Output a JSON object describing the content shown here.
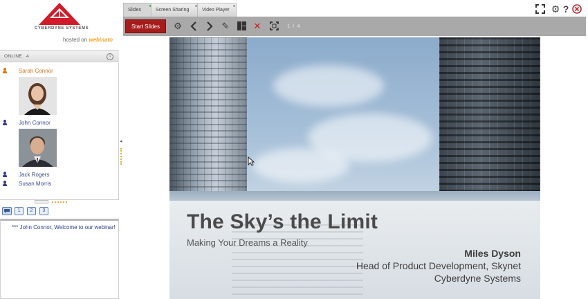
{
  "brand": {
    "logo_text": "CYBERDYNE SYSTEMS",
    "hosted_prefix": "hosted on",
    "hosted_brand": "webinato",
    "logo_color": "#d01c2a"
  },
  "sidebar": {
    "online_label": "ONLINE",
    "online_count": "4",
    "people": [
      {
        "name": "Sarah Connor",
        "role": "presenter"
      },
      {
        "name": "John Connor",
        "role": "attendee"
      },
      {
        "name": "Jack Rogers",
        "role": "attendee"
      },
      {
        "name": "Susan Morris",
        "role": "attendee"
      }
    ]
  },
  "chat": {
    "tabs": [
      "1",
      "2",
      "3"
    ],
    "message": "*** John Connor, Welcome to our webinar!"
  },
  "tabs": [
    {
      "label": "Slides",
      "active": true
    },
    {
      "label": "Screen Sharing",
      "active": false
    },
    {
      "label": "Video Player",
      "active": false
    }
  ],
  "toolbar": {
    "start_label": "Start Slides",
    "page_count": "1 / 4",
    "icons": [
      "gear-icon",
      "prev-icon",
      "next-icon",
      "pencil-icon",
      "layout-icon",
      "delete-icon",
      "fullscreen-icon"
    ]
  },
  "top_icons": [
    "fullscreen-icon",
    "settings-icon",
    "help-icon",
    "close-icon"
  ],
  "slide": {
    "title": "The Sky’s the Limit",
    "subtitle": "Making Your Dreams a Reality",
    "speaker_name": "Miles Dyson",
    "speaker_title": "Head of Product Development, Skynet",
    "speaker_company": "Cyberdyne Systems"
  },
  "colors": {
    "accent_red": "#a51c1c",
    "toolbar_gray": "#a9a9a9",
    "presenter_orange": "#d9751a",
    "attendee_blue": "#3a3a8c"
  }
}
